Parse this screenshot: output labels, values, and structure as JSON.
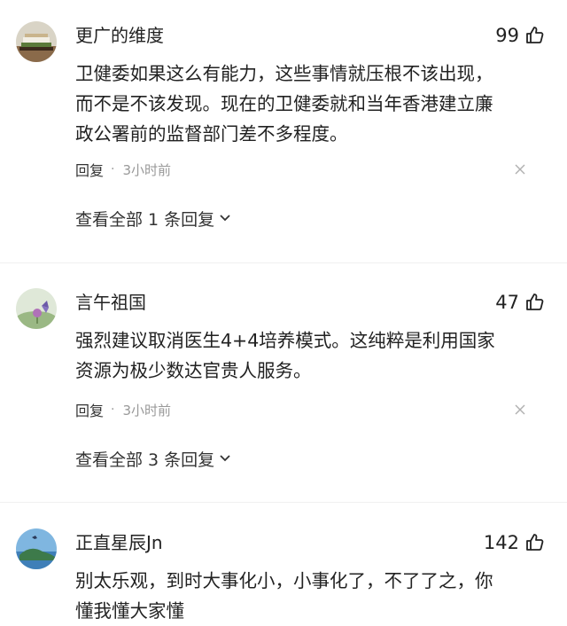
{
  "comments": [
    {
      "username": "更广的维度",
      "likes": "99",
      "lines": [
        "卫健委如果这么有能力，这些事情就压根不该出现，",
        "而不是不该发现。现在的卫健委就和当年香港建立廉",
        "政公署前的监督部门差不多程度。"
      ],
      "reply_label": "回复",
      "separator": "·",
      "time": "3小时前",
      "view_replies": "查看全部 1 条回复",
      "avatar_icon": "books-avatar-icon"
    },
    {
      "username": "言午祖国",
      "likes": "47",
      "lines": [
        "强烈建议取消医生4+4培养模式。这纯粹是利用国家",
        "资源为极少数达官贵人服务。"
      ],
      "reply_label": "回复",
      "separator": "·",
      "time": "3小时前",
      "view_replies": "查看全部 3 条回复",
      "avatar_icon": "butterfly-flower-avatar-icon"
    },
    {
      "username": "正直星辰Jn",
      "likes": "142",
      "lines": [
        "别太乐观，到时大事化小，小事化了，不了了之，你",
        "懂我懂大家懂"
      ],
      "avatar_icon": "island-sky-avatar-icon"
    }
  ],
  "colors": {
    "text": "#222222",
    "meta": "#999999",
    "background": "#ffffff"
  }
}
